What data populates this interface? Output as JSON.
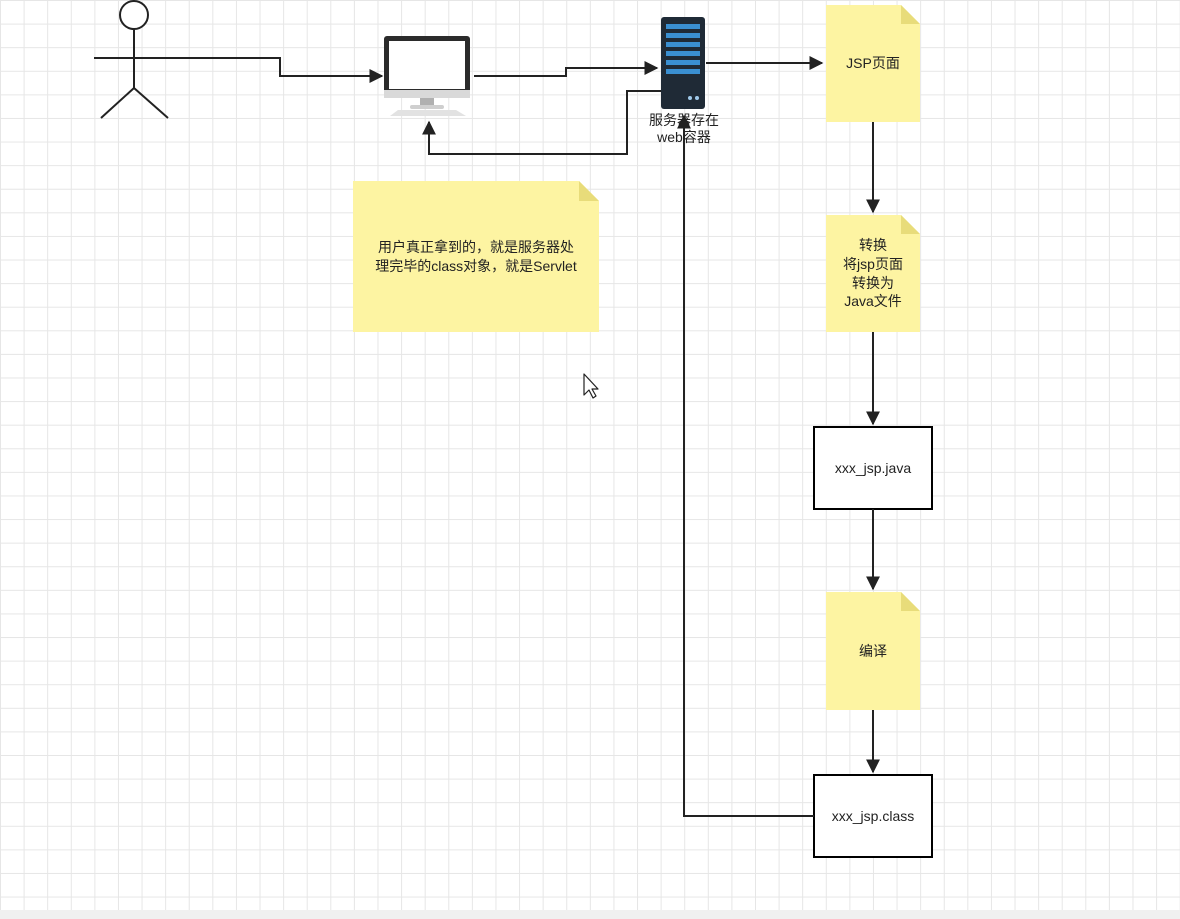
{
  "colors": {
    "note_fill": "#fdf4a2",
    "note_fold": "#e8dc7a",
    "line": "#222222",
    "box_border": "#000000",
    "monitor_dark": "#2b2b2b",
    "server_dark": "#1f2a36",
    "server_accent": "#3a8fd1"
  },
  "actor": {
    "icon": "stick-figure-icon"
  },
  "computer": {
    "icon": "desktop-monitor-icon"
  },
  "server": {
    "icon": "server-rack-icon",
    "label": "服务器存在\nweb容器"
  },
  "notes": {
    "jsp_page": "JSP页面",
    "convert": "转换\n将jsp页面\n转换为\nJava文件",
    "compile": "编译",
    "user_receives": "用户真正拿到的，就是服务器处\n理完毕的class对象，就是Servlet"
  },
  "boxes": {
    "java_file": "xxx_jsp.java",
    "class_file": "xxx_jsp.class"
  },
  "cursor": {
    "icon": "mouse-pointer-icon"
  }
}
